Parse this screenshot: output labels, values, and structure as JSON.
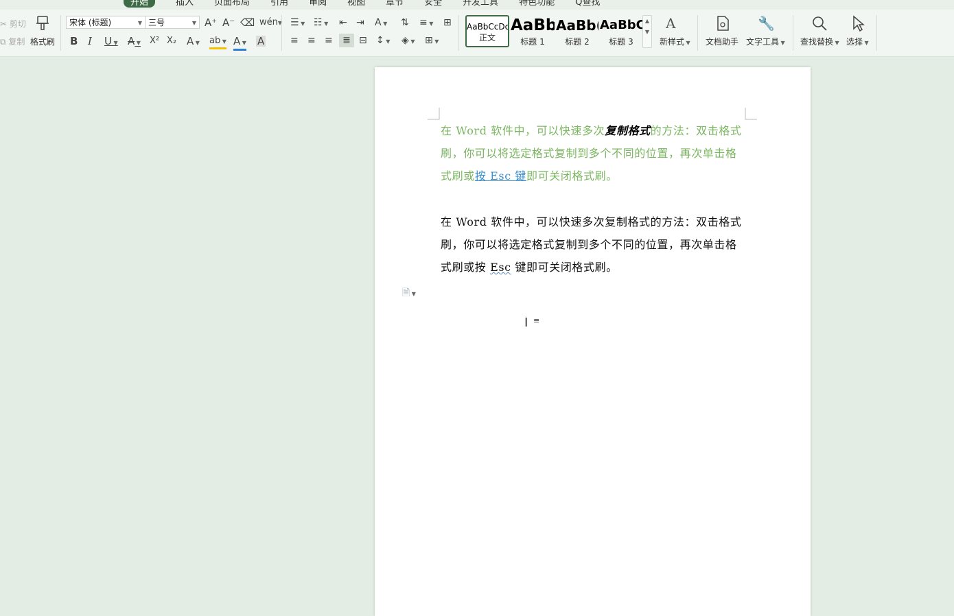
{
  "tabs": {
    "items": [
      "开始",
      "插入",
      "页面布局",
      "引用",
      "审阅",
      "视图",
      "章节",
      "安全",
      "开发工具",
      "特色功能",
      "Q查找"
    ],
    "active": "开始"
  },
  "clipboard": {
    "cut_label": "剪切",
    "copy_label": "复制",
    "format_painter_label": "格式刷"
  },
  "font": {
    "family_value": "宋体 (标题)",
    "size_value": "三号",
    "grow_icon": "A⁺",
    "shrink_icon": "A⁻",
    "clear_icon": "eraser-icon",
    "pinyin_icon": "wén",
    "bold": "B",
    "italic": "I",
    "underline": "U",
    "strike": "A",
    "superscript": "X²",
    "subscript": "X₂",
    "effects": "A",
    "highlight": "ab",
    "font_color": "A",
    "char_shade": "A"
  },
  "styles": {
    "items": [
      {
        "sample": "AaBbCcDd",
        "label": "正文"
      },
      {
        "sample": "AaBb",
        "label": "标题 1"
      },
      {
        "sample": "AaBb(",
        "label": "标题 2"
      },
      {
        "sample": "AaBbC(",
        "label": "标题 3"
      }
    ],
    "active_index": 0
  },
  "tools": {
    "new_style_label": "新样式",
    "doc_assistant_label": "文档助手",
    "text_tools_label": "文字工具",
    "find_replace_label": "查找替换",
    "select_label": "选择"
  },
  "document": {
    "para1": {
      "a": "在 Word 软件中，可以快速多次",
      "b": "复制格式",
      "c": "的方法：双击格式刷，你可以将选定格式复制到多个不同的位置，再次单击格式刷或",
      "d": "按 Esc 键",
      "e": "即可关闭格式刷。"
    },
    "para2": {
      "a": "在 Word 软件中，可以快速多次复制格式的方法：双击格式刷，你可以将选定格式复制到多个不同的位置，再次单击格式刷或按 ",
      "b": "Esc",
      "c": " 键即可关闭格式刷。"
    }
  },
  "colors": {
    "accent": "#3d6b45",
    "green_text": "#7bb661",
    "link": "#3a8fd0",
    "workspace": "#e3ede3"
  }
}
